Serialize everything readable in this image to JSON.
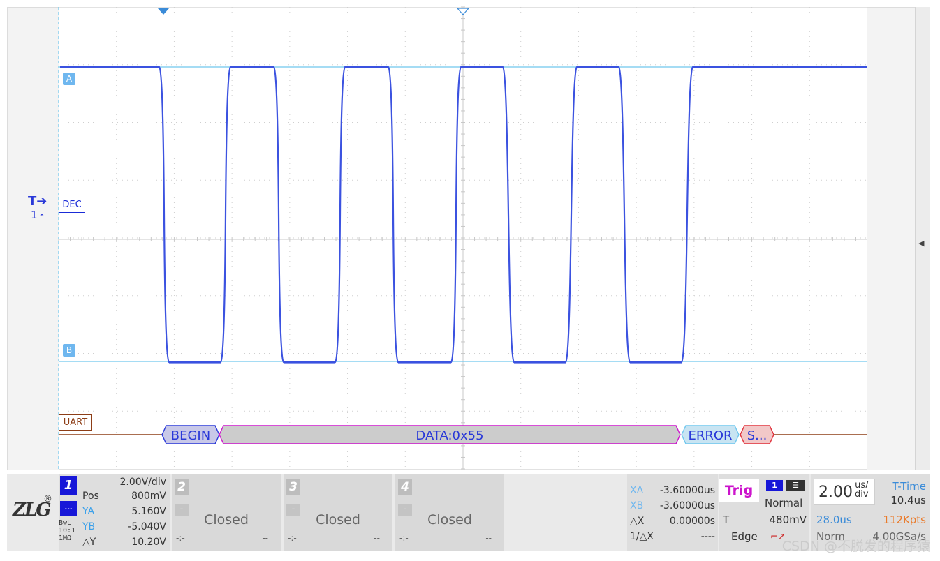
{
  "markers": {
    "channel_a": "A",
    "channel_b": "B",
    "decoder_label": "DEC",
    "trigger_label": "T",
    "trigger_source_label": "1",
    "uart_label": "UART"
  },
  "decode_packets": [
    {
      "label": "BEGIN",
      "color": "#2a39d8",
      "fill": "#c8c8c8"
    },
    {
      "label": "DATA:0x55",
      "color": "#2a39d8",
      "fill": "#c8c8c8"
    },
    {
      "label": "ERROR",
      "color": "#2a39d8",
      "fill": "#c8c8c8"
    },
    {
      "label": "S...",
      "color": "#2a39d8",
      "fill": "#c8c8c8"
    }
  ],
  "colors": {
    "waveform": "#3b52e0",
    "cursor": "#6fc7ee",
    "uart_line": "#8d3e17",
    "packet_border": "#cc14cc"
  },
  "channel1": {
    "number": "1",
    "scale": "2.00V/div",
    "pos_label": "Pos",
    "pos_value": "800mV",
    "coupling_icon": "dc-coupling-icon",
    "ya_label": "YA",
    "ya_value": "5.160V",
    "yb_label": "YB",
    "yb_value": "-5.040V",
    "dy_label": "△Y",
    "dy_value": "10.20V",
    "bwl_lines": [
      "BwL",
      "10:1",
      "1MΩ"
    ]
  },
  "channels_closed": [
    {
      "number": "2",
      "minus": "-",
      "status": "Closed",
      "dash_top": "--",
      "dash_mid": "--",
      "dash_bottom": "--",
      "dash_left": "-:-"
    },
    {
      "number": "3",
      "minus": "-",
      "status": "Closed",
      "dash_top": "--",
      "dash_mid": "--",
      "dash_bottom": "--",
      "dash_left": "-:-"
    },
    {
      "number": "4",
      "minus": "-",
      "status": "Closed",
      "dash_top": "--",
      "dash_mid": "--",
      "dash_bottom": "--",
      "dash_left": "-:-"
    }
  ],
  "cursor": {
    "xa_label": "XA",
    "xa_value": "-3.60000us",
    "xb_label": "XB",
    "xb_value": "-3.60000us",
    "dx_label": "△X",
    "dx_value": "0.00000s",
    "inv_label": "1/△X",
    "inv_value": "----"
  },
  "trigger": {
    "label": "Trig",
    "source": "1",
    "mode": "Normal",
    "t_label": "T",
    "level": "480mV",
    "type": "Edge"
  },
  "timebase": {
    "value": "2.00",
    "unit_top": "us/",
    "unit_bottom": "div",
    "ttime_label": "T-Time",
    "ttime_value": "10.4us",
    "delay": "28.0us",
    "memory_depth": "112Kpts",
    "acq_mode": "Norm",
    "sample_rate": "4.00GSa/s"
  },
  "logo": {
    "text": "ZLG",
    "registered": "®"
  },
  "watermark": "CSDN @不脱发的程序猿"
}
